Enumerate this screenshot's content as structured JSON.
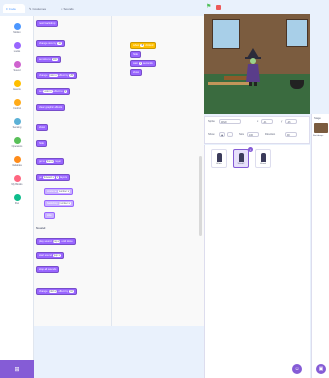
{
  "tabs": {
    "code": "Code",
    "costumes": "Costumes",
    "sounds": "Sounds"
  },
  "categories": [
    {
      "label": "Motion",
      "color": "#4c97ff"
    },
    {
      "label": "Looks",
      "color": "#9966ff"
    },
    {
      "label": "Sound",
      "color": "#cf63cf"
    },
    {
      "label": "Events",
      "color": "#ffbf00"
    },
    {
      "label": "Control",
      "color": "#ffab19"
    },
    {
      "label": "Sensing",
      "color": "#5cb1d6"
    },
    {
      "label": "Operators",
      "color": "#59c059"
    },
    {
      "label": "Variables",
      "color": "#ff8c1a"
    },
    {
      "label": "My Blocks",
      "color": "#ff6680"
    },
    {
      "label": "Pen",
      "color": "#0fbd8c"
    }
  ],
  "palette": {
    "blocks": [
      {
        "text": "next backdrop",
        "style": "looks"
      },
      {
        "text": "change size by",
        "slot": "10",
        "style": "looks"
      },
      {
        "text": "set size to",
        "slot": "100",
        "style": "looks"
      },
      {
        "text": "change",
        "slot": "color ▾",
        "extra": "effect by",
        "slot2": "25",
        "style": "looks"
      },
      {
        "text": "set",
        "slot": "color ▾",
        "extra": "effect to",
        "slot2": "0",
        "style": "looks"
      },
      {
        "text": "clear graphic effects",
        "style": "looks"
      },
      {
        "text": "show",
        "style": "looks"
      },
      {
        "text": "hide",
        "style": "looks"
      },
      {
        "text": "go to",
        "slot": "front ▾",
        "extra": "layer",
        "style": "looks"
      },
      {
        "text": "go",
        "slot": "forward ▾",
        "slot2": "1",
        "extra": "layers",
        "style": "looks"
      },
      {
        "text": "costume",
        "slot": "number ▾",
        "style": "looks-light"
      },
      {
        "text": "backdrop",
        "slot": "number ▾",
        "style": "looks-light"
      },
      {
        "text": "size",
        "style": "looks-light"
      },
      {
        "text": "play sound",
        "slot": "pop ▾",
        "extra": "until done",
        "style": "looks"
      },
      {
        "text": "start sound",
        "slot": "pop ▾",
        "style": "looks"
      },
      {
        "text": "stop all sounds",
        "style": "looks"
      },
      {
        "text": "change",
        "slot": "pitch ▾",
        "extra": "effect by",
        "slot2": "10",
        "style": "looks"
      }
    ],
    "sound_header": "Sound"
  },
  "script": [
    {
      "text": "when",
      "slot": "",
      "extra": "clicked",
      "style": "events"
    },
    {
      "text": "hide",
      "style": "looks"
    },
    {
      "text": "wait",
      "slot": "1",
      "extra": "seconds",
      "style": "looks"
    },
    {
      "text": "show",
      "style": "looks"
    }
  ],
  "zoom": {
    "in": "+",
    "out": "−",
    "reset": "="
  },
  "sprite_info": {
    "sprite_label": "Sprite",
    "sprite_name": "Witch",
    "x_label": "x",
    "x_value": "-41",
    "y_label": "y",
    "y_value": "-26",
    "show_label": "Show",
    "size_label": "Size",
    "size_value": "100",
    "direction_label": "Direction",
    "direction_value": "90"
  },
  "sprites": [
    {
      "name": "Witch",
      "selected": false
    },
    {
      "name": "Witch2",
      "selected": true
    },
    {
      "name": "Wand",
      "selected": false
    }
  ],
  "stage_panel": {
    "label": "Stage",
    "backdrops_label": "Backdrops"
  },
  "selected_badge": "×"
}
